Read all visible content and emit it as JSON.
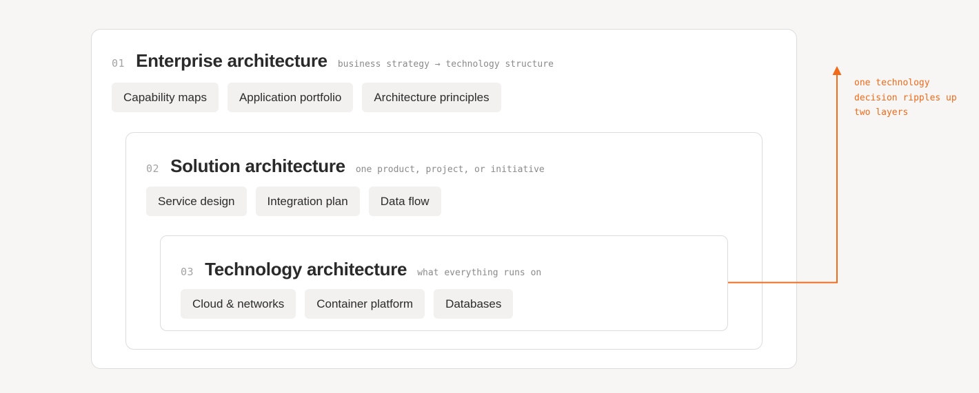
{
  "accent_color": "#f06a1a",
  "layers": [
    {
      "number": "01",
      "title": "Enterprise architecture",
      "subtitle": "business strategy → technology structure",
      "chips": [
        "Capability maps",
        "Application portfolio",
        "Architecture principles"
      ]
    },
    {
      "number": "02",
      "title": "Solution architecture",
      "subtitle": "one product, project, or initiative",
      "chips": [
        "Service design",
        "Integration plan",
        "Data flow"
      ]
    },
    {
      "number": "03",
      "title": "Technology architecture",
      "subtitle": "what everything runs on",
      "chips": [
        "Cloud & networks",
        "Container platform",
        "Databases"
      ]
    }
  ],
  "annotation": {
    "lines": [
      "one technology",
      "decision ripples up",
      "two layers"
    ],
    "arrow_direction": "up"
  }
}
